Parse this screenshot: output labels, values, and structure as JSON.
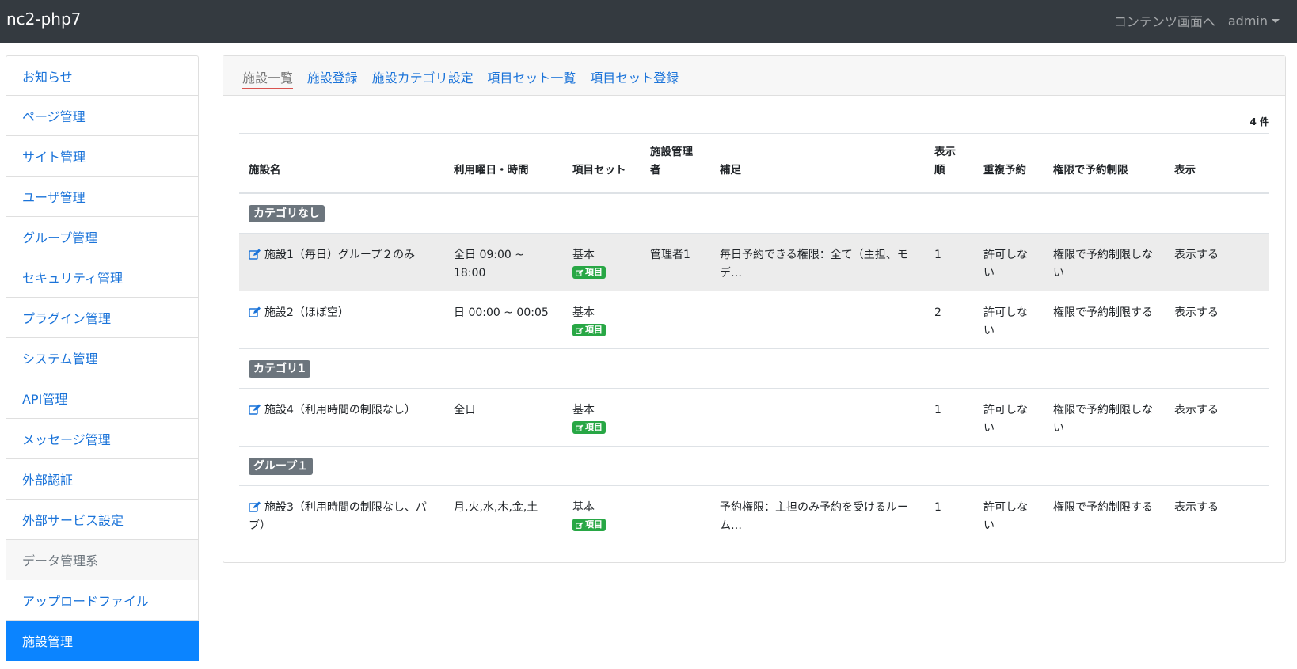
{
  "navbar": {
    "brand": "nc2-php7",
    "contents_link": "コンテンツ画面へ",
    "user": "admin"
  },
  "sidebar": {
    "items": [
      {
        "label": "お知らせ"
      },
      {
        "label": "ページ管理"
      },
      {
        "label": "サイト管理"
      },
      {
        "label": "ユーザ管理"
      },
      {
        "label": "グループ管理"
      },
      {
        "label": "セキュリティ管理"
      },
      {
        "label": "プラグイン管理"
      },
      {
        "label": "システム管理"
      },
      {
        "label": "API管理"
      },
      {
        "label": "メッセージ管理"
      },
      {
        "label": "外部認証"
      },
      {
        "label": "外部サービス設定"
      },
      {
        "label": "データ管理系"
      },
      {
        "label": "アップロードファイル"
      },
      {
        "label": "施設管理"
      }
    ]
  },
  "tabs": [
    {
      "label": "施設一覧"
    },
    {
      "label": "施設登録"
    },
    {
      "label": "施設カテゴリ設定"
    },
    {
      "label": "項目セット一覧"
    },
    {
      "label": "項目セット登録"
    }
  ],
  "count_label": "4 件",
  "table": {
    "headers": {
      "name": "施設名",
      "hours": "利用曜日・時間",
      "itemset": "項目セット",
      "manager": "施設管理者",
      "note": "補足",
      "order": "表示順",
      "duplicate": "重複予約",
      "restriction": "権限で予約制限",
      "display": "表示"
    },
    "item_badge_label": "項目",
    "categories": [
      {
        "name": "カテゴリなし",
        "rows": [
          {
            "name": "施設1（毎日）グループ２のみ",
            "hours": "全日 09:00 ~ 18:00",
            "itemset": "基本",
            "manager": "管理者1",
            "note": "毎日予約できる権限：全て（主担、モデ…",
            "order": "1",
            "duplicate": "許可しない",
            "restriction": "権限で予約制限しない",
            "display": "表示する"
          },
          {
            "name": "施設2（ほぼ空）",
            "hours": "日 00:00 ~ 00:05",
            "itemset": "基本",
            "manager": "",
            "note": "",
            "order": "2",
            "duplicate": "許可しない",
            "restriction": "権限で予約制限する",
            "display": "表示する"
          }
        ]
      },
      {
        "name": "カテゴリ1",
        "rows": [
          {
            "name": "施設4（利用時間の制限なし）",
            "hours": "全日",
            "itemset": "基本",
            "manager": "",
            "note": "",
            "order": "1",
            "duplicate": "許可しない",
            "restriction": "権限で予約制限しない",
            "display": "表示する"
          }
        ]
      },
      {
        "name": "グループ１",
        "rows": [
          {
            "name": "施設3（利用時間の制限なし、パブ）",
            "hours": "月,火,水,木,金,土",
            "itemset": "基本",
            "manager": "",
            "note": "予約権限：主担のみ予約を受けるルーム…",
            "order": "1",
            "duplicate": "許可しない",
            "restriction": "権限で予約制限する",
            "display": "表示する"
          }
        ]
      }
    ]
  },
  "colors": {
    "navbar": "#343a40",
    "link": "#1a73d9",
    "active_menu": "#0b84ff",
    "category_badge": "#6c757d",
    "item_badge": "#28a745",
    "active_tab_underline": "#d9534f"
  },
  "icons": {
    "edit": "edit-square-icon",
    "caret": "caret-down-icon"
  }
}
